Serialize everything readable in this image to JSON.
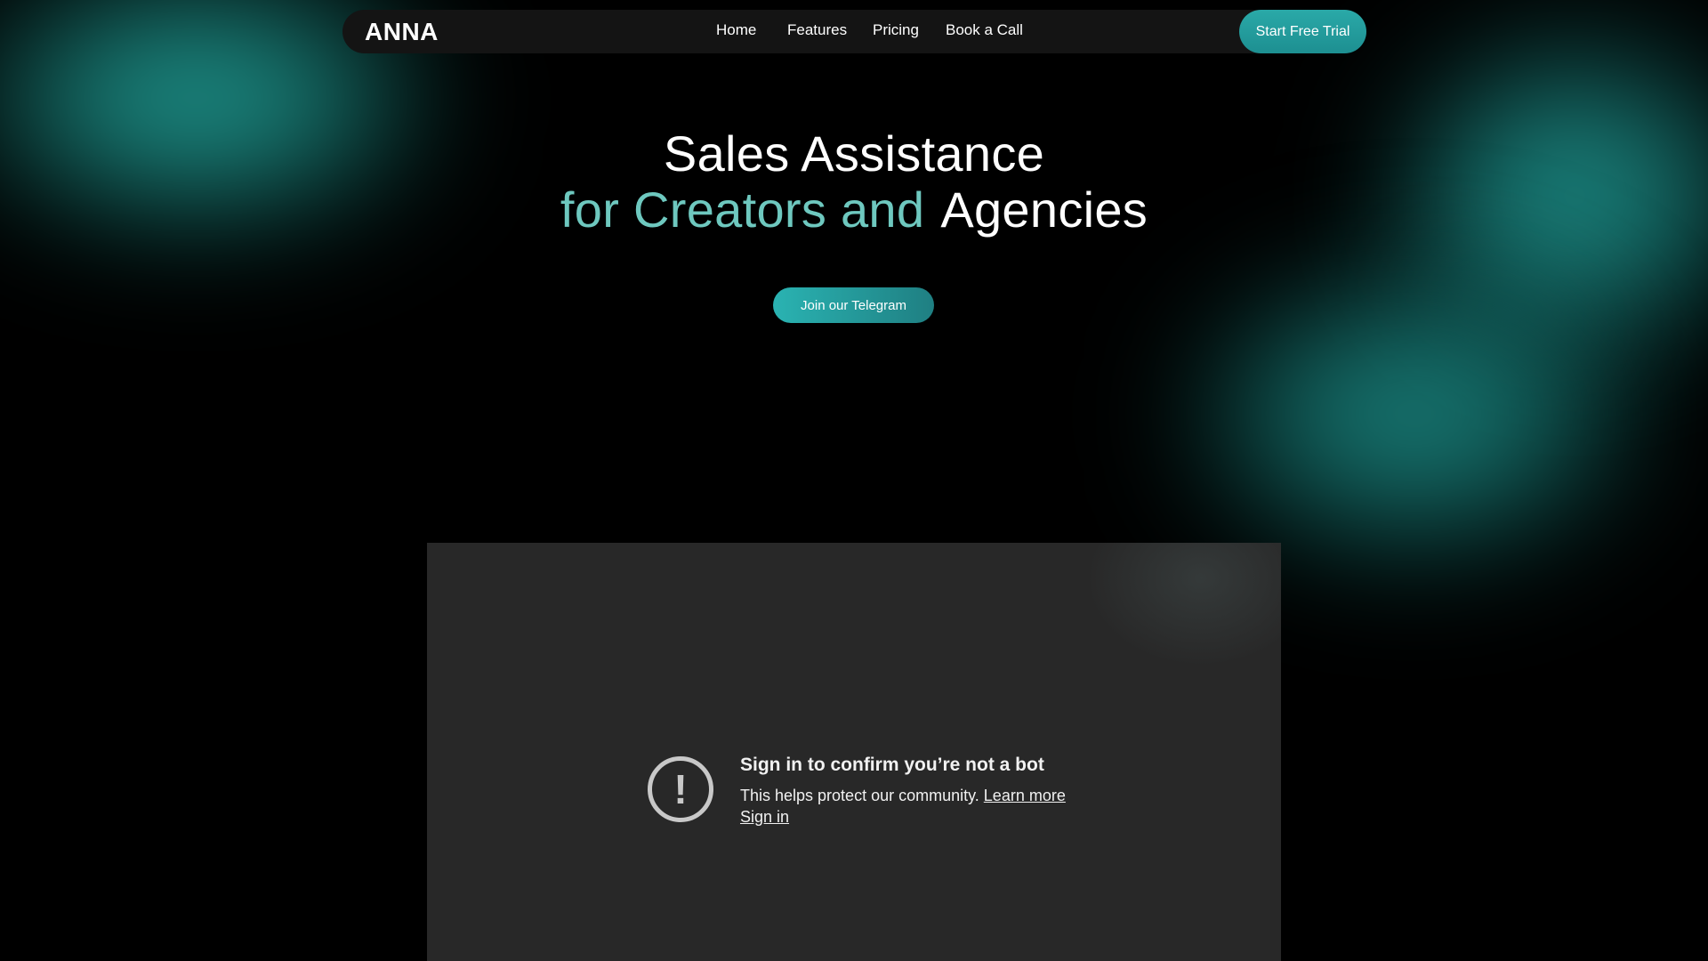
{
  "brand": {
    "logo_text": "ANNA",
    "accent_color": "#6ec8bf",
    "button_color": "#2aa9a8"
  },
  "nav": {
    "links": [
      {
        "label": "Home"
      },
      {
        "label": "Features"
      },
      {
        "label": "Pricing"
      },
      {
        "label": "Book a Call"
      }
    ],
    "cta_label": "Start Free Trial"
  },
  "hero": {
    "title_line1": "Sales Assistance",
    "title_line2_accent": "for Creators and",
    "title_line2_plain": "Agencies",
    "cta_label": "Join our Telegram"
  },
  "video_embed": {
    "icon": "alert-circle-icon",
    "title": "Sign in to confirm you’re not a bot",
    "body": "This helps protect our community.",
    "learn_more_label": "Learn more",
    "sign_in_label": "Sign in"
  }
}
